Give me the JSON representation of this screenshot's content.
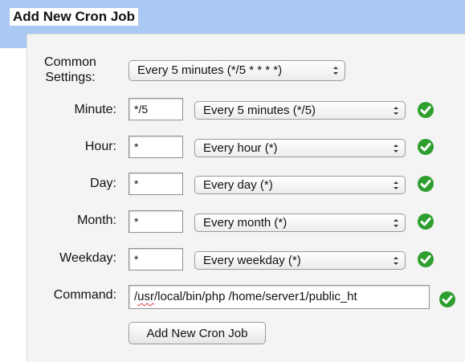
{
  "panel": {
    "title": "Add New Cron Job"
  },
  "form": {
    "common": {
      "label": "Common\nSettings:",
      "select_value": "Every 5 minutes (*/5 * * * *)"
    },
    "minute": {
      "label": "Minute:",
      "value": "*/5",
      "select_value": "Every 5 minutes (*/5)"
    },
    "hour": {
      "label": "Hour:",
      "value": "*",
      "select_value": "Every hour (*)"
    },
    "day": {
      "label": "Day:",
      "value": "*",
      "select_value": "Every day (*)"
    },
    "month": {
      "label": "Month:",
      "value": "*",
      "select_value": "Every month (*)"
    },
    "weekday": {
      "label": "Weekday:",
      "value": "*",
      "select_value": "Every weekday (*)"
    },
    "command": {
      "label": "Command:",
      "value_prefix": "/",
      "value_flagged": "usr",
      "value_rest": "/local/bin/php /home/server1/public_ht"
    },
    "submit_label": "Add New Cron Job"
  },
  "icons": {
    "valid": "check-circle-icon",
    "select_arrows": "up-down-arrows-icon"
  },
  "colors": {
    "header_band": "#a9c9f3",
    "valid_green": "#2e9e2e",
    "spelling_underline": "#d83a3a"
  }
}
